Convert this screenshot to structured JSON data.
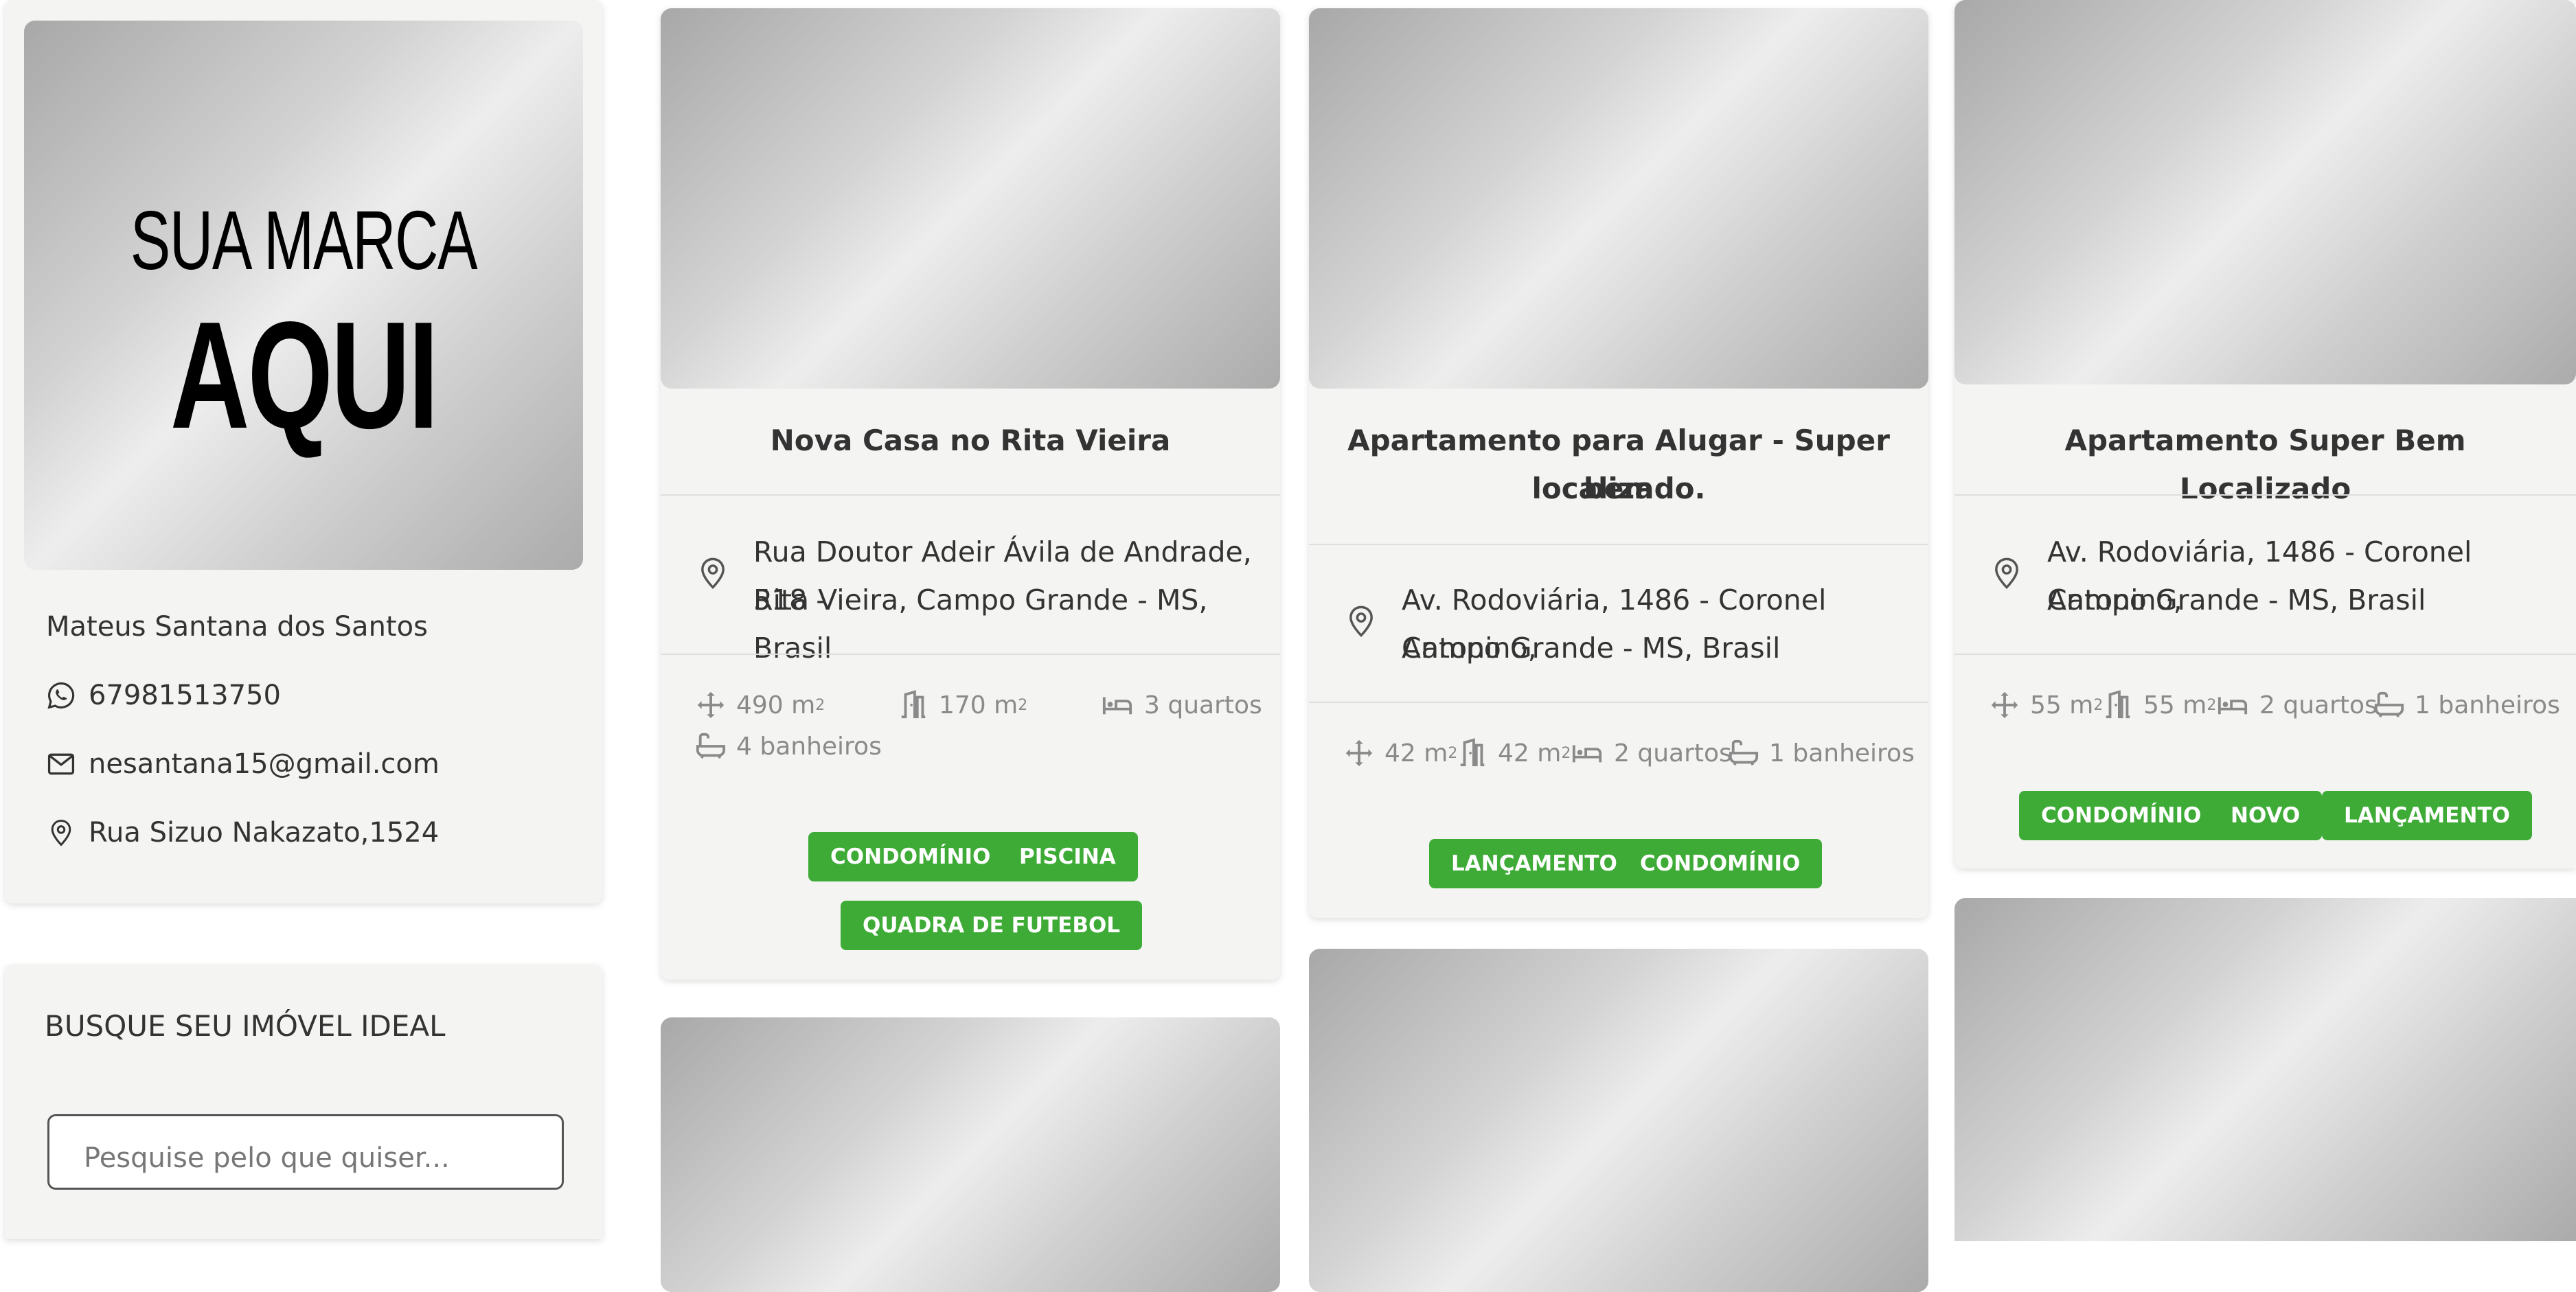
{
  "brand": {
    "line1": "SUA MARCA",
    "line2": "AQUI"
  },
  "agent": {
    "name": "Mateus Santana dos Santos",
    "phone": "67981513750",
    "email": "nesantana15@gmail.com",
    "address": "Rua Sizuo Nakazato,1524"
  },
  "search": {
    "title": "BUSQUE SEU IMÓVEL IDEAL",
    "placeholder": "Pesquise pelo que quiser..."
  },
  "listings": [
    {
      "title": "Nova Casa no Rita Vieira",
      "address_line1": "Rua Doutor Adeir Ávila de Andrade, 518 -",
      "address_line2": "Rita Vieira, Campo Grande - MS, Brasil",
      "area_total": "490 m",
      "area_built": "170 m",
      "rooms": "3 quartos",
      "baths": "4 banheiros",
      "tags": [
        "CONDOMÍNIO",
        "PISCINA",
        "QUADRA DE FUTEBOL"
      ]
    },
    {
      "title_line1": "Apartamento para Alugar - Super bem",
      "title_line2": "localizado.",
      "address_line1": "Av. Rodoviária, 1486 - Coronel Antonino,",
      "address_line2": "Campo Grande - MS, Brasil",
      "area_total": "42 m",
      "area_built": "42 m",
      "rooms": "2 quartos",
      "baths": "1 banheiros",
      "tags": [
        "LANÇAMENTO",
        "CONDOMÍNIO"
      ]
    },
    {
      "title": "Apartamento Super Bem Localizado",
      "address_line1": "Av. Rodoviária, 1486 - Coronel Antonino,",
      "address_line2": "Campo Grande - MS, Brasil",
      "area_total": "55 m",
      "area_built": "55 m",
      "rooms": "2 quartos",
      "baths": "1 banheiros",
      "tags": [
        "CONDOMÍNIO",
        "NOVO",
        "LANÇAMENTO"
      ]
    }
  ],
  "icons": {
    "area": "move-arrows-icon",
    "built": "door-icon",
    "rooms": "bed-icon",
    "baths": "bathtub-icon",
    "location": "map-pin-icon",
    "phone": "whatsapp-icon",
    "email": "envelope-icon"
  },
  "colors": {
    "tag": "#3eab37",
    "card": "#f4f4f2"
  }
}
